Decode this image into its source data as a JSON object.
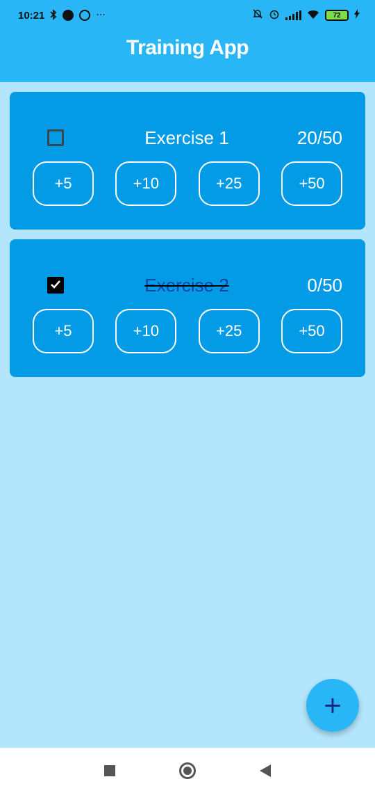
{
  "status_bar": {
    "time": "10:21",
    "left_icons": [
      "bluetooth-icon",
      "spotify-icon",
      "target-icon",
      "more-dots-icon"
    ],
    "right_icons": [
      "notifications-muted-icon",
      "alarm-icon",
      "signal-icon",
      "wifi-icon",
      "battery-icon",
      "charging-icon"
    ],
    "battery_level": "72",
    "dots": "···"
  },
  "app": {
    "title": "Training App"
  },
  "colors": {
    "header": "#29b6f6",
    "background": "#b3e5fc",
    "card": "#039be5",
    "fab": "#29b6f6",
    "fab_icon": "#1a237e"
  },
  "exercises": [
    {
      "name": "Exercise 1",
      "count": "20/50",
      "checked": false,
      "buttons": [
        "+5",
        "+10",
        "+25",
        "+50"
      ]
    },
    {
      "name": "Exercise 2",
      "count": "0/50",
      "checked": true,
      "buttons": [
        "+5",
        "+10",
        "+25",
        "+50"
      ]
    }
  ],
  "fab": {
    "label": "+"
  },
  "nav_bar": {
    "icons": [
      "recents-square-icon",
      "home-circle-icon",
      "back-triangle-icon"
    ]
  }
}
